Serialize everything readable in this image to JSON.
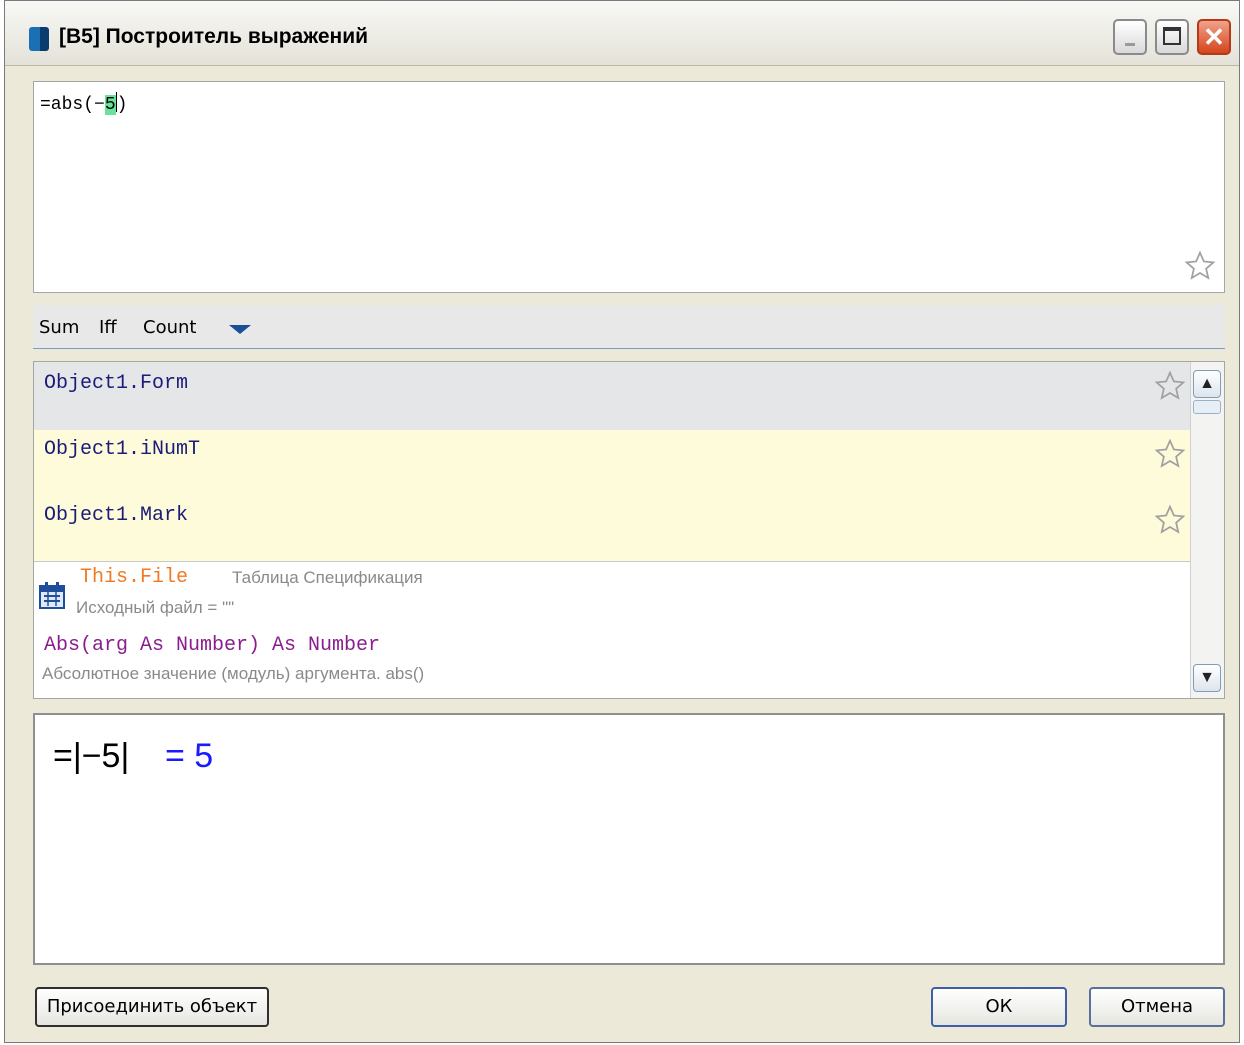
{
  "window": {
    "title": "[B5] Построитель выражений",
    "close_glyph": "✕"
  },
  "editor": {
    "prefix": "=abs(−",
    "highlight": "5",
    "suffix": ")"
  },
  "quickbar": {
    "items": [
      "Sum",
      "Iff",
      "Count"
    ]
  },
  "list": {
    "items": [
      {
        "label": "Object1.Form"
      },
      {
        "label": "Object1.iNumT"
      },
      {
        "label": "Object1.Mark"
      }
    ],
    "file": {
      "name": "This.File",
      "description": "Таблица Спецификация",
      "source": "Исходный файл = \"\""
    },
    "function": {
      "signature": "Abs(arg As Number) As Number",
      "description": "Абсолютное значение (модуль) аргумента. abs()"
    },
    "scroll_up_glyph": "▲",
    "scroll_down_glyph": "▼"
  },
  "result": {
    "expression": "=|−5|",
    "value": "= 5"
  },
  "buttons": {
    "attach": "Присоединить объект",
    "ok": "ОК",
    "cancel": "Отмена"
  },
  "colors": {
    "highlight": "#69e39c",
    "result_value": "#1a1aff",
    "file_name": "#f07a23",
    "function_sig": "#8b1e8e"
  }
}
